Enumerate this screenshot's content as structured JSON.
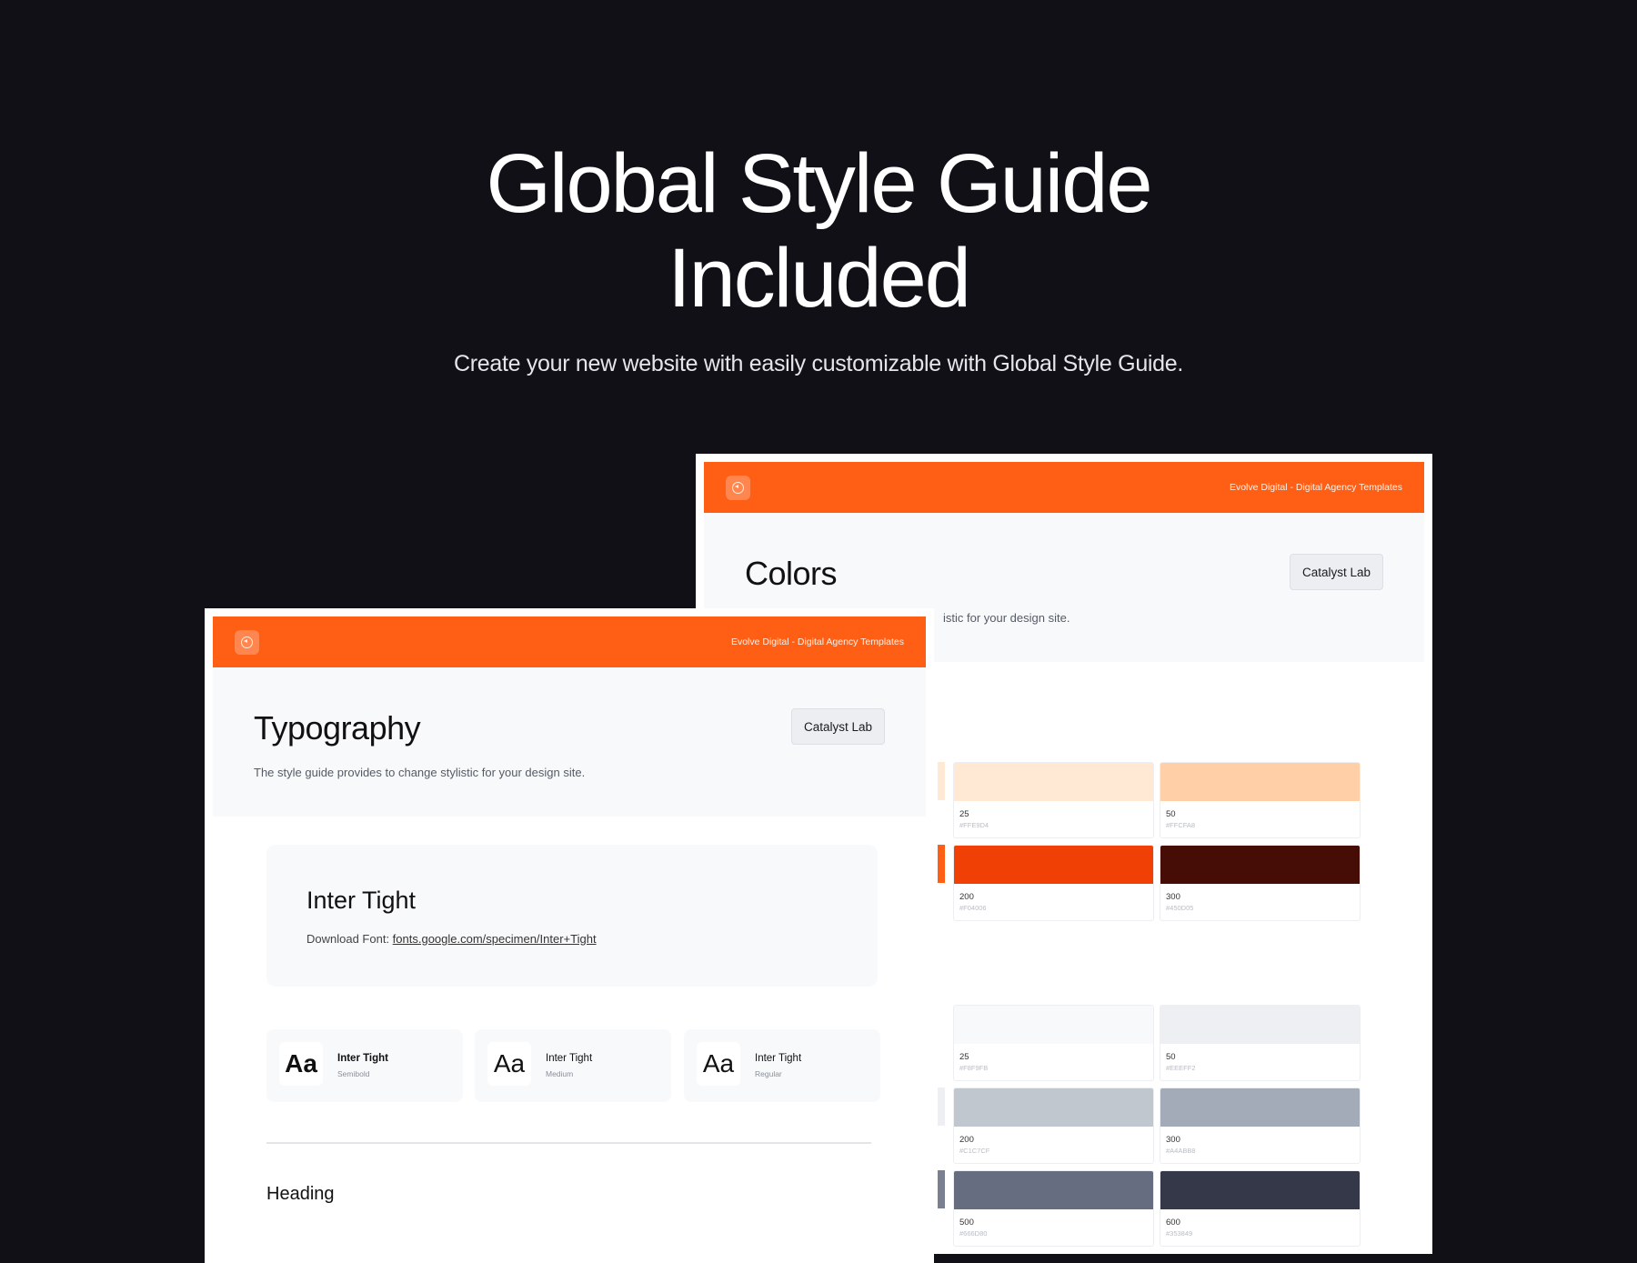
{
  "hero": {
    "title_line1": "Global Style Guide",
    "title_line2": "Included",
    "subtitle": "Create your new website with easily customizable with Global Style Guide."
  },
  "colors_window": {
    "topbar_text": "Evolve Digital  - Digital Agency Templates",
    "title": "Colors",
    "description_visible": "istic for your design site.",
    "button": "Catalyst Lab"
  },
  "typography_window": {
    "topbar_text": "Evolve Digital  - Digital Agency Templates",
    "title": "Typography",
    "description": "The style guide provides to change stylistic for your design site.",
    "button": "Catalyst Lab",
    "font_card": {
      "name": "Inter Tight",
      "download_label": "Download Font: ",
      "download_link": "fonts.google.com/specimen/Inter+Tight"
    },
    "weights": [
      {
        "sample": "Aa",
        "name": "Inter Tight",
        "style": "Semibold"
      },
      {
        "sample": "Aa",
        "name": "Inter Tight",
        "style": "Medium"
      },
      {
        "sample": "Aa",
        "name": "Inter Tight",
        "style": "Regular"
      }
    ],
    "section_heading": "Heading"
  },
  "swatches": {
    "orange": [
      {
        "label": "25",
        "hex": "#FFE9D4",
        "color": "#FFE9D4"
      },
      {
        "label": "50",
        "hex": "#FFCFA8",
        "color": "#FFCFA8"
      },
      {
        "label": "200",
        "hex": "#F04006",
        "color": "#F04006"
      },
      {
        "label": "300",
        "hex": "#450D05",
        "color": "#450D05"
      }
    ],
    "gray": [
      {
        "label": "25",
        "hex": "#F8F9FB",
        "color": "#F8F9FB"
      },
      {
        "label": "50",
        "hex": "#EEEFF2",
        "color": "#EEEFF2"
      },
      {
        "label": "200",
        "hex": "#C1C7CF",
        "color": "#C1C7CF"
      },
      {
        "label": "300",
        "hex": "#A4ABB8",
        "color": "#A4ABB8"
      },
      {
        "label": "500",
        "hex": "#666D80",
        "color": "#666D80"
      },
      {
        "label": "600",
        "hex": "#353849",
        "color": "#353849"
      }
    ]
  },
  "colors": {
    "brand_orange": "#FF5F15",
    "background": "#111016"
  }
}
